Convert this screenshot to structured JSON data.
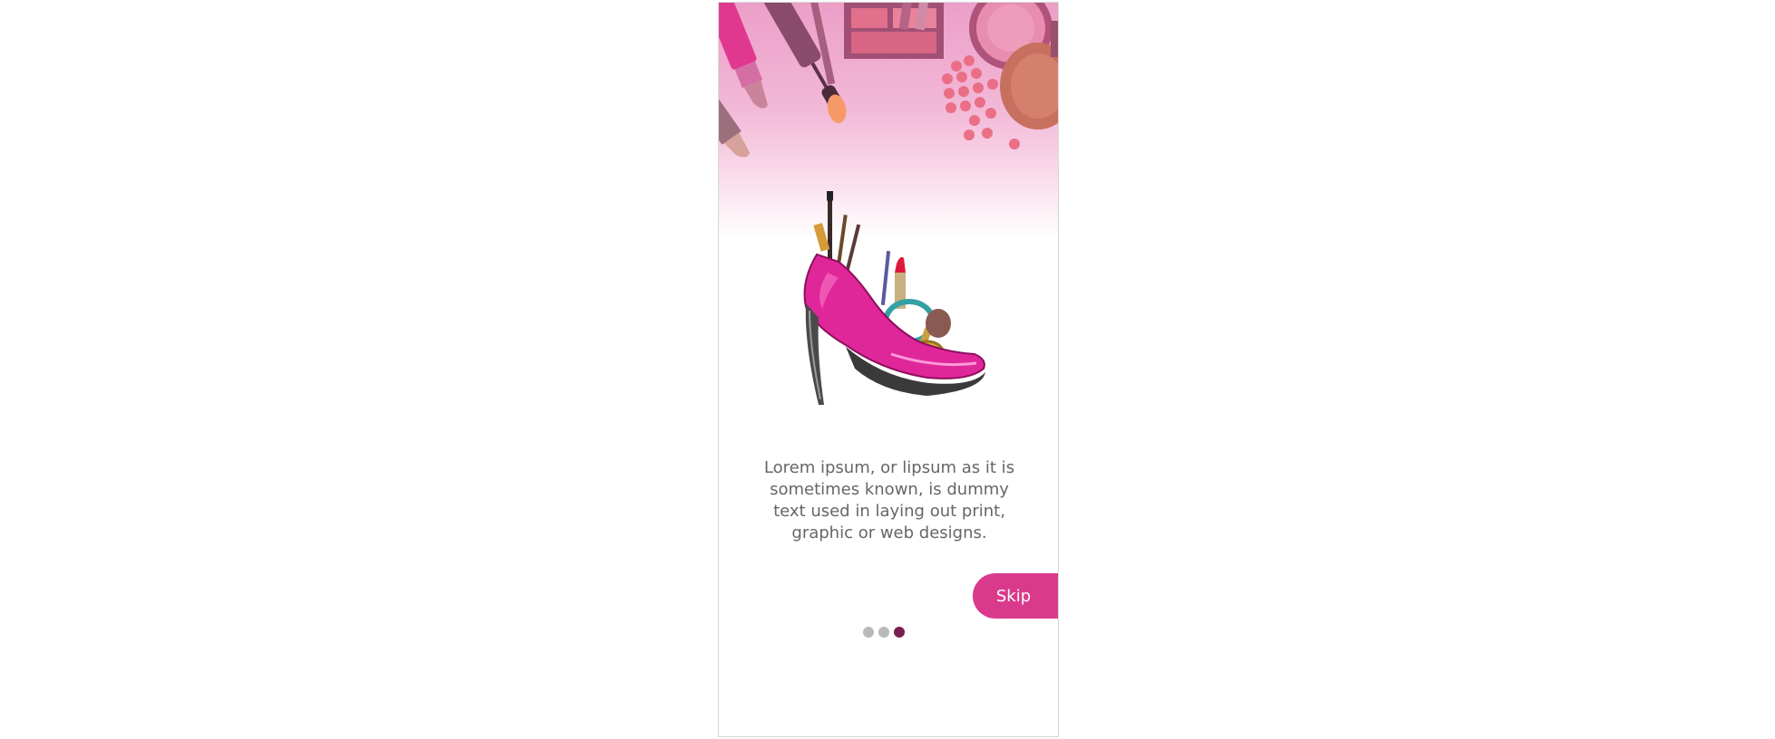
{
  "onboarding": {
    "description": "Lorem ipsum, or lipsum as it is sometimes known, is dummy text used in laying out print, graphic or web designs.",
    "skip_label": "Skip",
    "pagination": {
      "total": 3,
      "active_index": 2
    },
    "hero_icon": "cosmetics-flatlay",
    "illustration_icon": "high-heel-makeup-icon"
  },
  "colors": {
    "accent": "#d93a8c",
    "dot_active": "#7a1e52",
    "dot_inactive": "#b9b9b9",
    "text": "#666666",
    "hero_pink": "#ec9fc8"
  }
}
